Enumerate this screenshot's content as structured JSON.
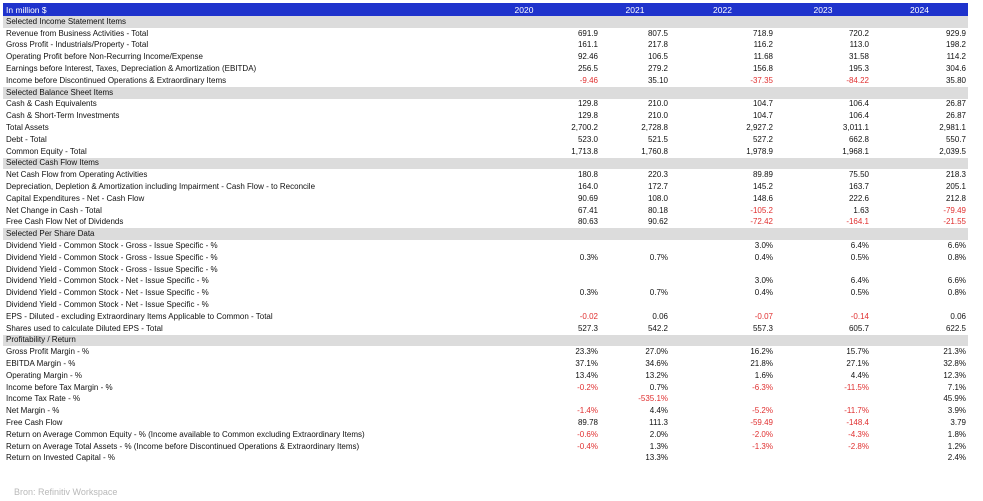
{
  "header": {
    "unit_label": "In million $",
    "years": [
      "2020",
      "2021",
      "2022",
      "2023",
      "2024"
    ]
  },
  "rows": [
    {
      "type": "section",
      "label": "Selected Income Statement Items"
    },
    {
      "type": "data",
      "label": "Revenue from Business Activities - Total",
      "values": [
        "691.9",
        "807.5",
        "718.9",
        "720.2",
        "929.9"
      ]
    },
    {
      "type": "data",
      "label": "Gross Profit - Industrials/Property - Total",
      "values": [
        "161.1",
        "217.8",
        "116.2",
        "113.0",
        "198.2"
      ]
    },
    {
      "type": "data",
      "label": "Operating Profit before Non-Recurring Income/Expense",
      "values": [
        "92.46",
        "106.5",
        "11.68",
        "31.58",
        "114.2"
      ]
    },
    {
      "type": "data",
      "label": "Earnings before Interest, Taxes, Depreciation & Amortization (EBITDA)",
      "values": [
        "256.5",
        "279.2",
        "156.8",
        "195.3",
        "304.6"
      ]
    },
    {
      "type": "data",
      "label": "Income before Discontinued Operations & Extraordinary Items",
      "values": [
        "-9.46",
        "35.10",
        "-37.35",
        "-84.22",
        "35.80"
      ]
    },
    {
      "type": "section",
      "label": "Selected Balance Sheet Items"
    },
    {
      "type": "data",
      "label": "Cash & Cash Equivalents",
      "values": [
        "129.8",
        "210.0",
        "104.7",
        "106.4",
        "26.87"
      ]
    },
    {
      "type": "data",
      "label": "Cash & Short-Term Investments",
      "values": [
        "129.8",
        "210.0",
        "104.7",
        "106.4",
        "26.87"
      ]
    },
    {
      "type": "data",
      "label": "Total Assets",
      "values": [
        "2,700.2",
        "2,728.8",
        "2,927.2",
        "3,011.1",
        "2,981.1"
      ]
    },
    {
      "type": "data",
      "label": "Debt - Total",
      "values": [
        "523.0",
        "521.5",
        "527.2",
        "662.8",
        "550.7"
      ]
    },
    {
      "type": "data",
      "label": "Common Equity - Total",
      "values": [
        "1,713.8",
        "1,760.8",
        "1,978.9",
        "1,968.1",
        "2,039.5"
      ]
    },
    {
      "type": "section",
      "label": "Selected Cash Flow Items"
    },
    {
      "type": "data",
      "label": "Net Cash Flow from Operating Activities",
      "values": [
        "180.8",
        "220.3",
        "89.89",
        "75.50",
        "218.3"
      ]
    },
    {
      "type": "data",
      "label": "Depreciation, Depletion & Amortization including Impairment - Cash Flow - to Reconcile",
      "values": [
        "164.0",
        "172.7",
        "145.2",
        "163.7",
        "205.1"
      ]
    },
    {
      "type": "data",
      "label": "Capital Expenditures - Net - Cash Flow",
      "values": [
        "90.69",
        "108.0",
        "148.6",
        "222.6",
        "212.8"
      ]
    },
    {
      "type": "data",
      "label": "Net Change in Cash - Total",
      "values": [
        "67.41",
        "80.18",
        "-105.2",
        "1.63",
        "-79.49"
      ]
    },
    {
      "type": "data",
      "label": "Free Cash Flow Net of Dividends",
      "values": [
        "80.63",
        "90.62",
        "-72.42",
        "-164.1",
        "-21.55"
      ]
    },
    {
      "type": "section",
      "label": "Selected Per Share Data"
    },
    {
      "type": "data",
      "label": "Dividend Yield - Common Stock - Gross - Issue Specific - %",
      "values": [
        "",
        "",
        "3.0%",
        "6.4%",
        "6.6%"
      ]
    },
    {
      "type": "data",
      "label": "Dividend Yield - Common Stock - Gross - Issue Specific - %",
      "values": [
        "0.3%",
        "0.7%",
        "0.4%",
        "0.5%",
        "0.8%"
      ]
    },
    {
      "type": "data",
      "label": "Dividend Yield - Common Stock - Gross - Issue Specific - %",
      "values": [
        "",
        "",
        "",
        "",
        ""
      ]
    },
    {
      "type": "data",
      "label": "Dividend Yield - Common Stock - Net - Issue Specific - %",
      "values": [
        "",
        "",
        "3.0%",
        "6.4%",
        "6.6%"
      ]
    },
    {
      "type": "data",
      "label": "Dividend Yield - Common Stock - Net - Issue Specific - %",
      "values": [
        "0.3%",
        "0.7%",
        "0.4%",
        "0.5%",
        "0.8%"
      ]
    },
    {
      "type": "data",
      "label": "Dividend Yield - Common Stock - Net - Issue Specific - %",
      "values": [
        "",
        "",
        "",
        "",
        ""
      ]
    },
    {
      "type": "data",
      "label": "EPS - Diluted - excluding Extraordinary Items Applicable to Common - Total",
      "values": [
        "-0.02",
        "0.06",
        "-0.07",
        "-0.14",
        "0.06"
      ]
    },
    {
      "type": "data",
      "label": "Shares used to calculate Diluted EPS - Total",
      "values": [
        "527.3",
        "542.2",
        "557.3",
        "605.7",
        "622.5"
      ]
    },
    {
      "type": "section",
      "label": "Profitability / Return"
    },
    {
      "type": "data",
      "label": "Gross Profit Margin - %",
      "values": [
        "23.3%",
        "27.0%",
        "16.2%",
        "15.7%",
        "21.3%"
      ]
    },
    {
      "type": "data",
      "label": "EBITDA Margin - %",
      "values": [
        "37.1%",
        "34.6%",
        "21.8%",
        "27.1%",
        "32.8%"
      ]
    },
    {
      "type": "data",
      "label": "Operating Margin - %",
      "values": [
        "13.4%",
        "13.2%",
        "1.6%",
        "4.4%",
        "12.3%"
      ]
    },
    {
      "type": "data",
      "label": "Income before Tax Margin - %",
      "values": [
        "-0.2%",
        "0.7%",
        "-6.3%",
        "-11.5%",
        "7.1%"
      ]
    },
    {
      "type": "data",
      "label": "Income Tax Rate - %",
      "values": [
        "",
        "-535.1%",
        "",
        "",
        "45.9%"
      ]
    },
    {
      "type": "data",
      "label": "Net Margin - %",
      "values": [
        "-1.4%",
        "4.4%",
        "-5.2%",
        "-11.7%",
        "3.9%"
      ]
    },
    {
      "type": "data",
      "label": "Free Cash Flow",
      "values": [
        "89.78",
        "111.3",
        "-59.49",
        "-148.4",
        "3.79"
      ]
    },
    {
      "type": "data",
      "label": "Return on Average Common Equity - % (Income available to Common excluding Extraordinary Items)",
      "values": [
        "-0.6%",
        "2.0%",
        "-2.0%",
        "-4.3%",
        "1.8%"
      ]
    },
    {
      "type": "data",
      "label": "Return on Average Total Assets - % (Income before Discontinued Operations & Extraordinary Items)",
      "values": [
        "-0.4%",
        "1.3%",
        "-1.3%",
        "-2.8%",
        "1.2%"
      ]
    },
    {
      "type": "data",
      "label": "Return on Invested Capital - %",
      "values": [
        "",
        "13.3%",
        "",
        "",
        "2.4%"
      ]
    }
  ],
  "source": "Bron: Refinitiv Workspace",
  "colors": {
    "header_bg": "#1f33cc",
    "section_bg": "#dcdcdc",
    "negative": "#e03030"
  }
}
